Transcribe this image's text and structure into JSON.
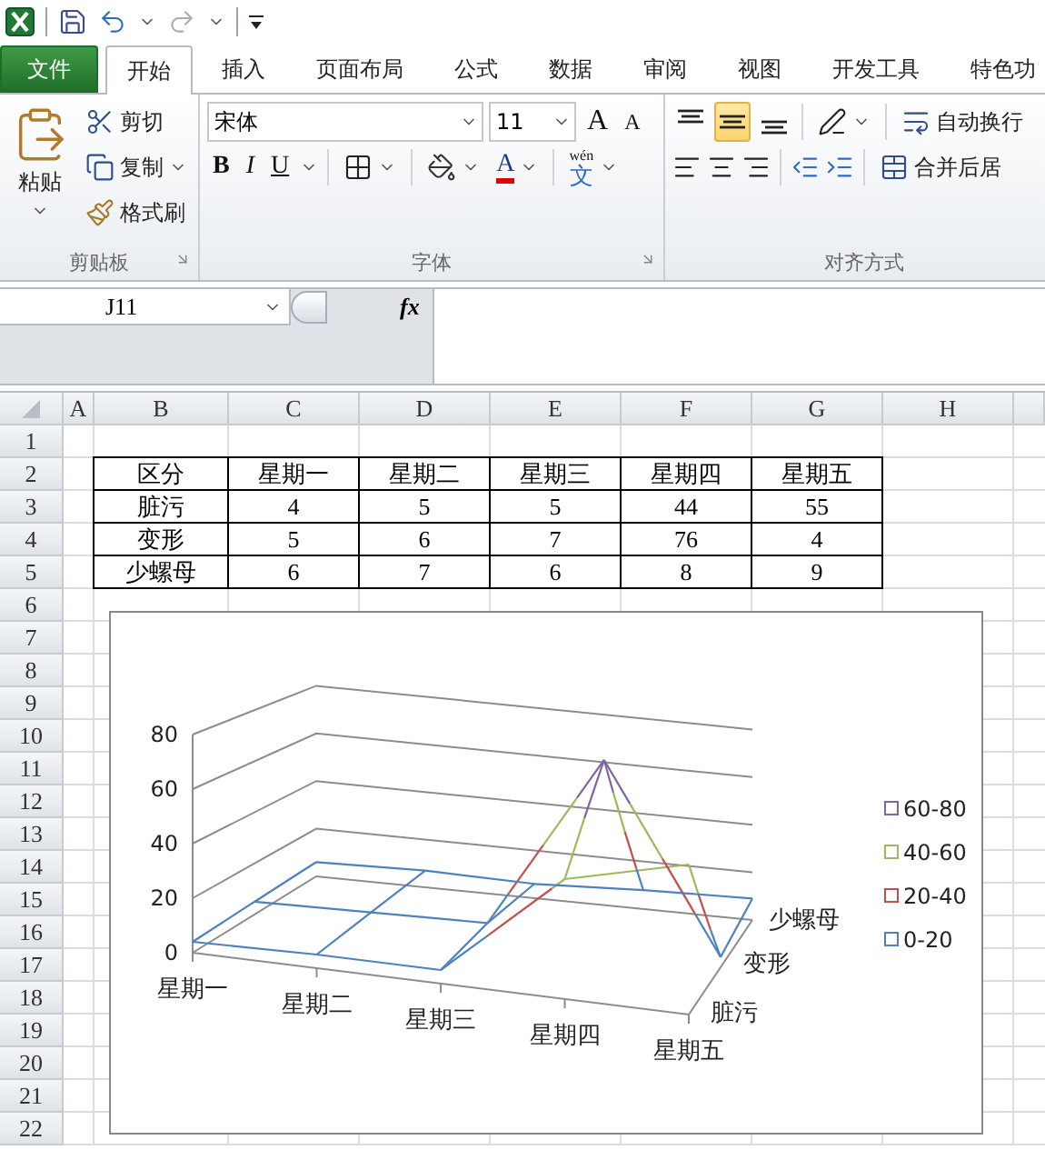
{
  "tabs": [
    {
      "label": "文件",
      "kind": "file",
      "selected": false
    },
    {
      "label": "开始",
      "kind": "tab",
      "selected": true
    },
    {
      "label": "插入",
      "kind": "tab",
      "selected": false
    },
    {
      "label": "页面布局",
      "kind": "tab",
      "selected": false
    },
    {
      "label": "公式",
      "kind": "tab",
      "selected": false
    },
    {
      "label": "数据",
      "kind": "tab",
      "selected": false
    },
    {
      "label": "审阅",
      "kind": "tab",
      "selected": false
    },
    {
      "label": "视图",
      "kind": "tab",
      "selected": false
    },
    {
      "label": "开发工具",
      "kind": "tab",
      "selected": false
    },
    {
      "label": "特色功",
      "kind": "tab",
      "selected": false
    }
  ],
  "clipboard": {
    "paste": "粘贴",
    "cut": "剪切",
    "copy": "复制",
    "format_painter": "格式刷",
    "label": "剪贴板"
  },
  "font": {
    "name": "宋体",
    "size": "11",
    "grow": "A",
    "shrink": "A",
    "styles": [
      {
        "kind": "bold",
        "label": "B"
      },
      {
        "kind": "italic",
        "label": "I"
      },
      {
        "kind": "underline",
        "label": "U"
      }
    ],
    "font_color": "A",
    "phonetic_top": "wén",
    "phonetic_bottom": "文",
    "label": "字体"
  },
  "alignment": {
    "vertical": [
      {
        "kind": "top",
        "selected": false
      },
      {
        "kind": "middle",
        "selected": true
      },
      {
        "kind": "bottom",
        "selected": false
      }
    ],
    "wrap": "自动换行",
    "merge": "合并后居",
    "label": "对齐方式"
  },
  "name_box": "J11",
  "function_label": "fx",
  "columns": [
    "A",
    "B",
    "C",
    "D",
    "E",
    "F",
    "G",
    "H"
  ],
  "rows": [
    "1",
    "2",
    "3",
    "4",
    "5",
    "6",
    "7",
    "8",
    "9",
    "10",
    "11",
    "12",
    "13",
    "14",
    "15",
    "16",
    "17",
    "18",
    "19",
    "20",
    "21",
    "22"
  ],
  "table": {
    "header": [
      "区分",
      "星期一",
      "星期二",
      "星期三",
      "星期四",
      "星期五"
    ],
    "rows": [
      [
        "脏污",
        "4",
        "5",
        "5",
        "44",
        "55"
      ],
      [
        "变形",
        "5",
        "6",
        "7",
        "76",
        "4"
      ],
      [
        "少螺母",
        "6",
        "7",
        "6",
        "8",
        "9"
      ]
    ]
  },
  "chart": {
    "y_ticks": [
      "80",
      "60",
      "40",
      "20",
      "0"
    ],
    "categories": [
      "星期一",
      "星期二",
      "星期三",
      "星期四",
      "星期五"
    ],
    "series": [
      "脏污",
      "变形",
      "少螺母"
    ],
    "legend": [
      {
        "label": "60-80",
        "color": "#8064a2"
      },
      {
        "label": "40-60",
        "color": "#9bbb59"
      },
      {
        "label": "20-40",
        "color": "#c0504d"
      },
      {
        "label": "0-20",
        "color": "#4f81bd"
      }
    ]
  }
}
